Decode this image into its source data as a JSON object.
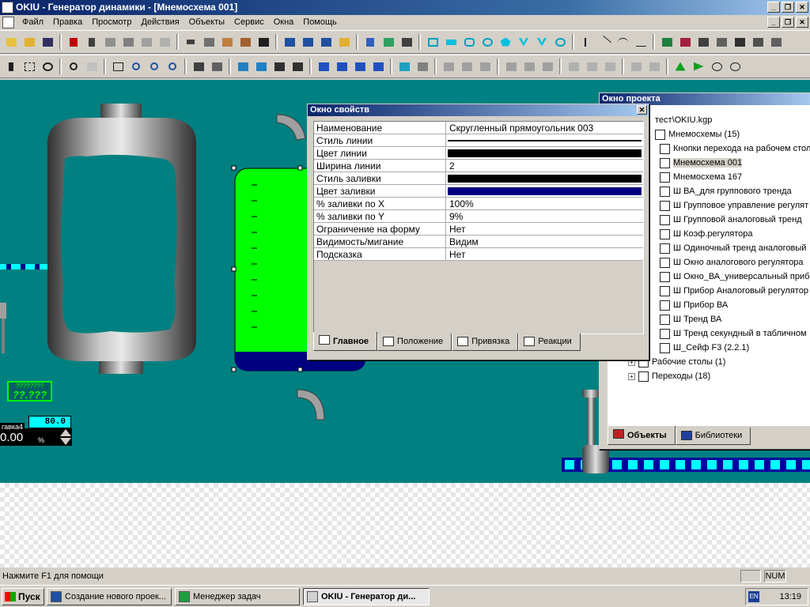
{
  "app": {
    "title": "OKIU - Генератор динамики - [Мнемосхема 001]"
  },
  "menu": [
    "Файл",
    "Правка",
    "Просмотр",
    "Действия",
    "Объекты",
    "Сервис",
    "Окна",
    "Помощь"
  ],
  "window_buttons": {
    "min": "_",
    "restore": "❐",
    "close": "✕"
  },
  "canvas": {
    "background": "#008080",
    "question_text": "????????",
    "question_big": "??.???",
    "indicator_value": "80.0",
    "indicator_label": "гавка4",
    "indicator_reading": "0.00",
    "indicator_unit": "%"
  },
  "props_window": {
    "title": "Окно свойств",
    "rows": [
      {
        "name": "Наименование",
        "value": "Скругленный прямоугольник 003"
      },
      {
        "name": "Стиль линии",
        "value": ""
      },
      {
        "name": "Цвет линии",
        "value": ""
      },
      {
        "name": "Ширина линии",
        "value": "2"
      },
      {
        "name": "Стиль заливки",
        "value": ""
      },
      {
        "name": "Цвет заливки",
        "value": ""
      },
      {
        "name": "% заливки по X",
        "value": "100%"
      },
      {
        "name": "% заливки по Y",
        "value": "9%"
      },
      {
        "name": "Ограничение на форму",
        "value": "Нет"
      },
      {
        "name": "Видимость/мигание",
        "value": "Видим"
      },
      {
        "name": "Подсказка",
        "value": "Нет"
      }
    ],
    "tabs": [
      "Главное",
      "Положение",
      "Привязка",
      "Реакции"
    ]
  },
  "project_window": {
    "title": "Окно проекта",
    "root": "тест\\OKIU.kgp",
    "mnemo_group": "Мнемосхемы (15)",
    "items": [
      "Кнопки перехода на рабочем стол",
      "Мнемосхема 001",
      "Мнемосхема 167",
      "Ш ВА_для группового тренда",
      "Ш Групповое управление регулят",
      "Ш Групповой аналоговый тренд",
      "Ш Коэф.регулятора",
      "Ш Одиночный тренд аналоговый",
      "Ш Окно аналогового регулятора",
      "Ш Окно_ВА_универсальный приб",
      "Ш Прибор Аналоговый регулятор",
      "Ш Прибор ВА",
      "Ш Тренд ВА",
      "Ш Тренд секундный в табличном",
      "Ш_Сейф F3 (2.2.1)"
    ],
    "desktops": "Рабочие столы (1)",
    "transitions": "Переходы (18)",
    "tabs": [
      "Объекты",
      "Библиотеки"
    ]
  },
  "statusbar": {
    "help": "Нажмите  F1 для помощи",
    "num": "NUM"
  },
  "taskbar": {
    "start": "Пуск",
    "tasks": [
      "Создание нового проек...",
      "Менеджер задач",
      "OKIU - Генератор ди..."
    ],
    "lang": "EN",
    "clock": "13:19"
  }
}
